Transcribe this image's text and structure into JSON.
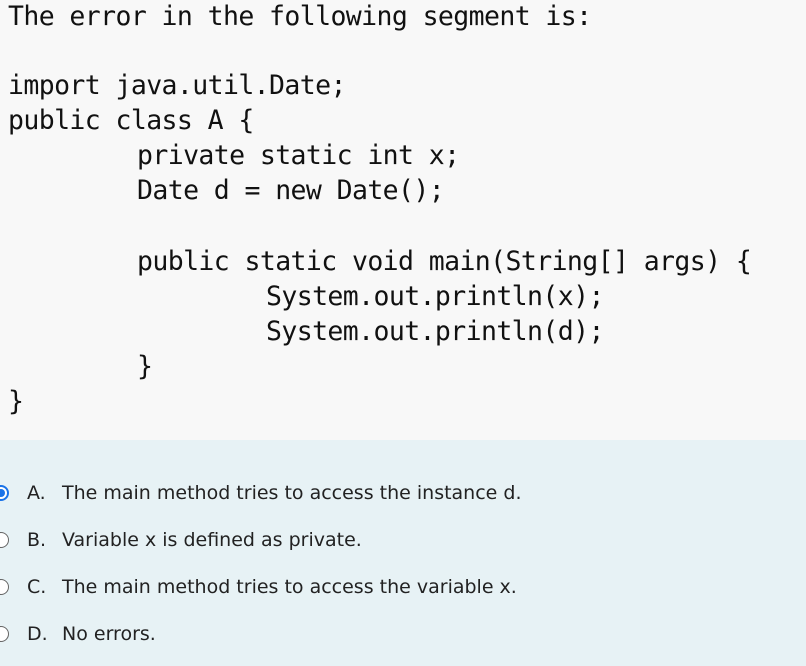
{
  "question": {
    "prompt": "The error in the following segment is:",
    "code_lines": [
      "import java.util.Date;",
      "public class A {",
      "private static int x;",
      "Date d = new Date();",
      "public static void main(String[] args) {",
      "System.out.println(x);",
      "System.out.println(d);",
      "}",
      "}"
    ]
  },
  "options": [
    {
      "letter": "A.",
      "text": "The main method tries to access the instance d.",
      "selected": true
    },
    {
      "letter": "B.",
      "text": "Variable x is defined as private.",
      "selected": false
    },
    {
      "letter": "C.",
      "text": "The main method tries to access the variable x.",
      "selected": false
    },
    {
      "letter": "D.",
      "text": "No errors.",
      "selected": false
    }
  ]
}
